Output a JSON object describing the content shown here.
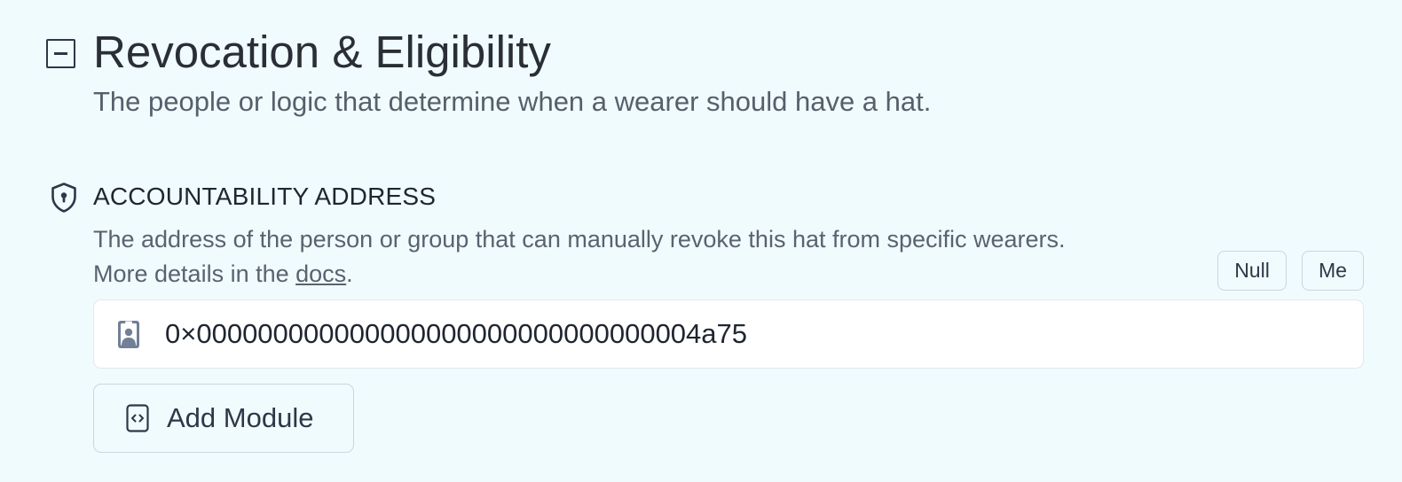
{
  "section": {
    "title": "Revocation & Eligibility",
    "subtitle": "The people or logic that determine when a wearer should have a hat."
  },
  "accountability": {
    "label": "ACCOUNTABILITY ADDRESS",
    "description_prefix": "The address of the person or group that can manually revoke this hat from specific wearers. More details in the ",
    "docs_link": "docs",
    "description_suffix": ".",
    "null_button": "Null",
    "me_button": "Me",
    "address_value": "0×000000000000000000000000000000004a75",
    "add_module_button": "Add Module"
  },
  "icons": {
    "collapse": "minus-square-icon",
    "shield": "shield-keyhole-icon",
    "address": "contact-card-icon",
    "module": "code-file-icon"
  },
  "colors": {
    "background": "#f0fbfd",
    "text": "#2d3748",
    "muted": "#5a6270",
    "border": "#cbd5e0",
    "input_bg": "#ffffff"
  }
}
